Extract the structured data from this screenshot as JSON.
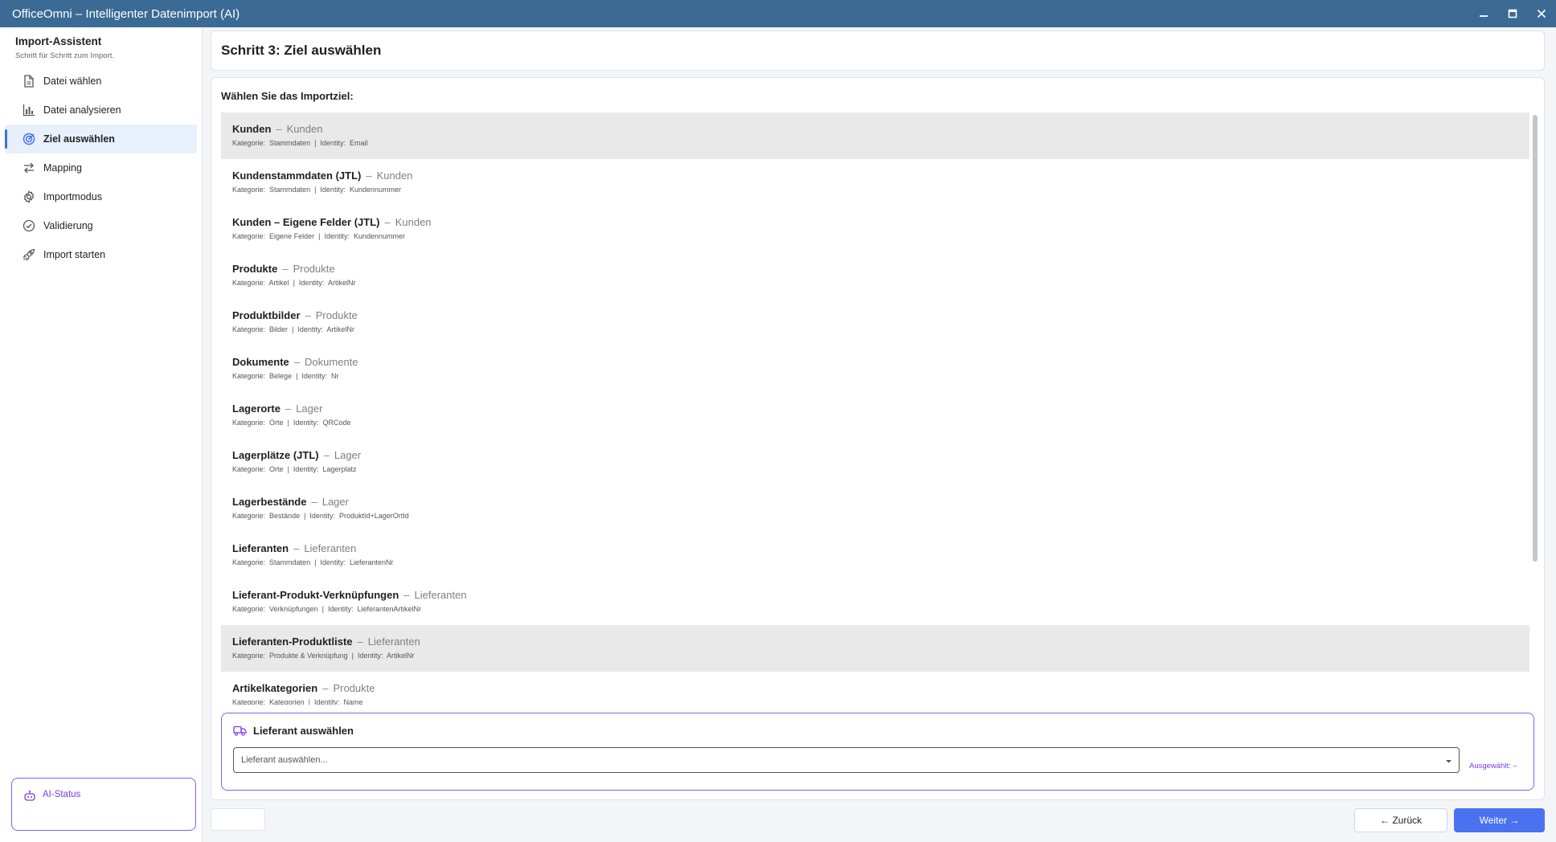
{
  "window": {
    "title": "OfficeOmni – Intelligenter Datenimport (AI)"
  },
  "sidebar": {
    "title": "Import-Assistent",
    "subtitle": "Schritt für Schritt zum Import.",
    "items": [
      {
        "label": "Datei wählen",
        "icon": "file-icon"
      },
      {
        "label": "Datei analysieren",
        "icon": "chart-icon"
      },
      {
        "label": "Ziel auswählen",
        "icon": "target-icon",
        "active": true
      },
      {
        "label": "Mapping",
        "icon": "arrows-icon"
      },
      {
        "label": "Importmodus",
        "icon": "gear-icon"
      },
      {
        "label": "Validierung",
        "icon": "check-circle-icon"
      },
      {
        "label": "Import starten",
        "icon": "rocket-icon"
      }
    ],
    "ai_status": "AI-Status"
  },
  "main": {
    "step_title": "Schritt 3: Ziel auswählen",
    "prompt": "Wählen Sie das Importziel:",
    "category_label": "Kategorie:",
    "identity_label": "Identity:",
    "targets": [
      {
        "name": "Kunden",
        "group": "Kunden",
        "category": "Stammdaten",
        "identity": "Email",
        "highlighted": true
      },
      {
        "name": "Kundenstammdaten (JTL)",
        "group": "Kunden",
        "category": "Stammdaten",
        "identity": "Kundennummer"
      },
      {
        "name": "Kunden – Eigene Felder (JTL)",
        "group": "Kunden",
        "category": "Eigene Felder",
        "identity": "Kundennummer"
      },
      {
        "name": "Produkte",
        "group": "Produkte",
        "category": "Artikel",
        "identity": "ArtikelNr"
      },
      {
        "name": "Produktbilder",
        "group": "Produkte",
        "category": "Bilder",
        "identity": "ArtikelNr"
      },
      {
        "name": "Dokumente",
        "group": "Dokumente",
        "category": "Belege",
        "identity": "Nr"
      },
      {
        "name": "Lagerorte",
        "group": "Lager",
        "category": "Orte",
        "identity": "QRCode"
      },
      {
        "name": "Lagerplätze (JTL)",
        "group": "Lager",
        "category": "Orte",
        "identity": "Lagerplatz"
      },
      {
        "name": "Lagerbestände",
        "group": "Lager",
        "category": "Bestände",
        "identity": "ProduktId+LagerOrtId"
      },
      {
        "name": "Lieferanten",
        "group": "Lieferanten",
        "category": "Stammdaten",
        "identity": "LieferantenNr"
      },
      {
        "name": "Lieferant-Produkt-Verknüpfungen",
        "group": "Lieferanten",
        "category": "Verknüpfungen",
        "identity": "LieferantenArtikelNr"
      },
      {
        "name": "Lieferanten-Produktliste",
        "group": "Lieferanten",
        "category": "Produkte & Verknüpfung",
        "identity": "ArtikelNr",
        "highlighted": true
      },
      {
        "name": "Artikelkategorien",
        "group": "Produkte",
        "category": "Kategorien",
        "identity": "Name"
      }
    ],
    "supplier": {
      "title": "Lieferant auswählen",
      "placeholder": "Lieferant auswählen...",
      "selected_label": "Ausgewählt: –"
    }
  },
  "footer": {
    "back_label": "← Zurück",
    "next_label": "Weiter →"
  },
  "colors": {
    "titlebar": "#3b6a94",
    "accent": "#4a72f0",
    "ai_purple": "#8b5cf6",
    "selected_row": "#e9e9e9"
  }
}
